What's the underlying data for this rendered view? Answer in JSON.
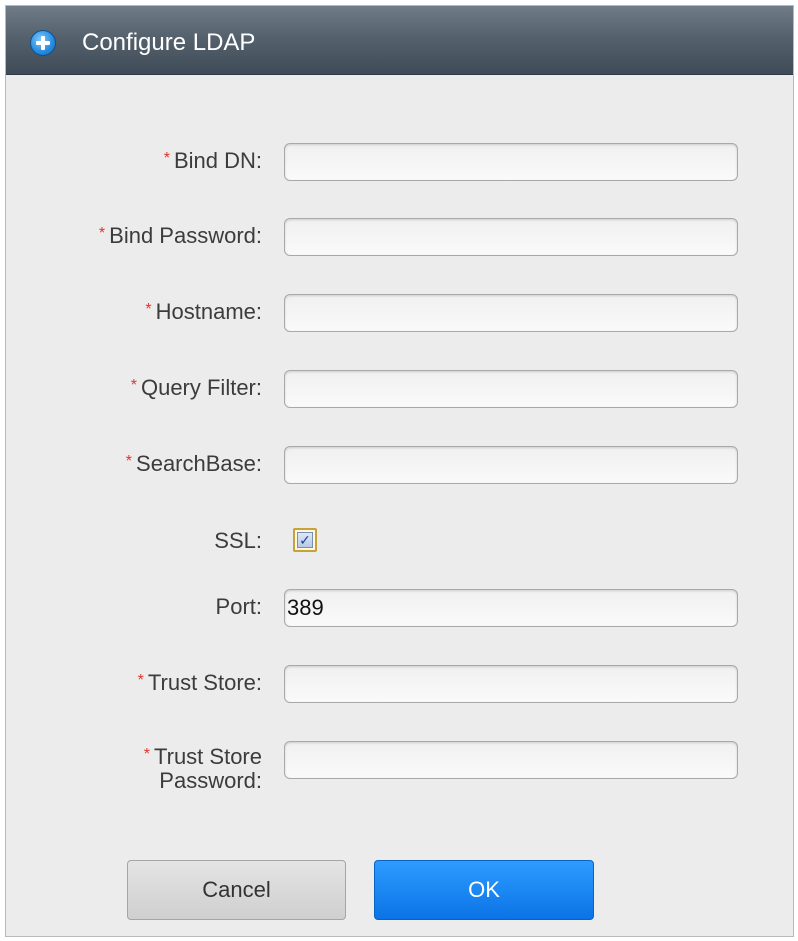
{
  "dialog": {
    "title": "Configure LDAP",
    "title_icon": "plus-circle-icon",
    "required_marker": "*",
    "accent_color": "#1a83f0"
  },
  "fields": {
    "bind_dn": {
      "label": "Bind DN:",
      "value": "",
      "required": true
    },
    "bind_password": {
      "label": "Bind Password:",
      "value": "",
      "required": true
    },
    "hostname": {
      "label": "Hostname:",
      "value": "",
      "required": true
    },
    "query_filter": {
      "label": "Query Filter:",
      "value": "",
      "required": true
    },
    "search_base": {
      "label": "SearchBase:",
      "value": "",
      "required": true
    },
    "ssl": {
      "label": "SSL:",
      "checked": true,
      "check_mark": "✓"
    },
    "port": {
      "label": "Port:",
      "value": "389",
      "required": false
    },
    "trust_store": {
      "label": "Trust Store:",
      "value": "",
      "required": true
    },
    "trust_store_password": {
      "label_line1": "Trust Store",
      "label_line2": "Password:",
      "value": "",
      "required": true
    }
  },
  "buttons": {
    "cancel_label": "Cancel",
    "ok_label": "OK"
  }
}
